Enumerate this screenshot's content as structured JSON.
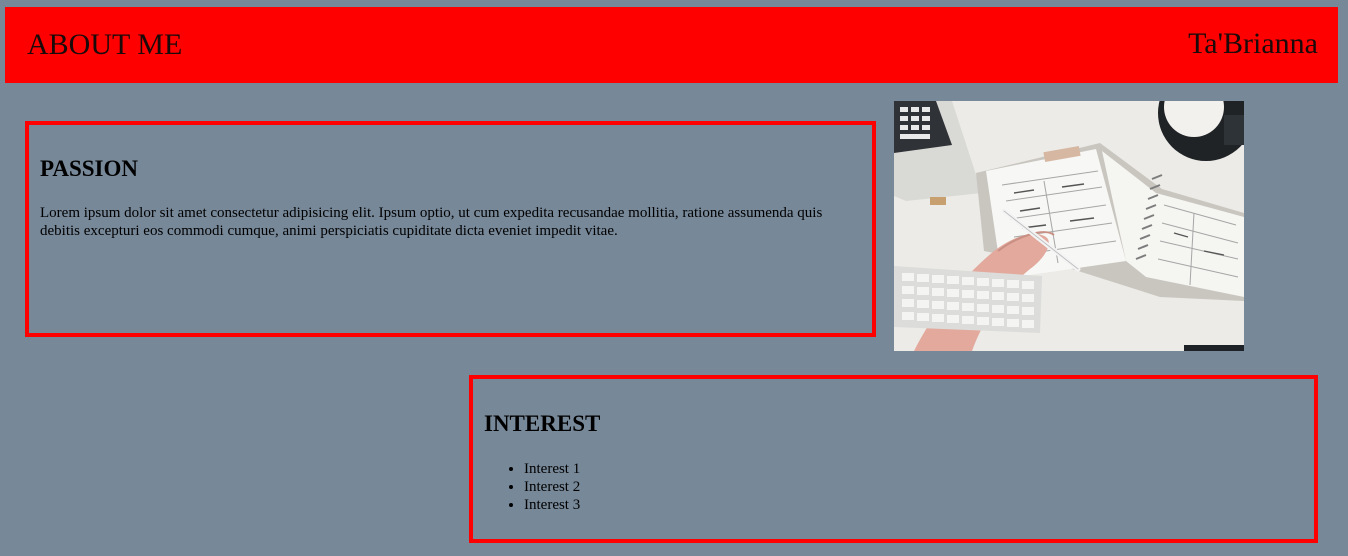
{
  "header": {
    "title": "ABOUT ME",
    "name": "Ta'Brianna",
    "background": "#ff0000"
  },
  "passion": {
    "heading": "PASSION",
    "text": "Lorem ipsum dolor sit amet consectetur adipisicing elit. Ipsum optio, ut cum expedita recusandae mollitia, ratione assumenda quis debitis excepturi eos commodi cumque, animi perspiciatis cupiditate dicta eveniet impedit vitae."
  },
  "photo": {
    "icon": "desk-planner-photo"
  },
  "interest": {
    "heading": "INTEREST",
    "items": [
      "Interest 1",
      "Interest 2",
      "Interest 3"
    ]
  },
  "colors": {
    "page_background": "#778899",
    "border": "#ff0000"
  }
}
